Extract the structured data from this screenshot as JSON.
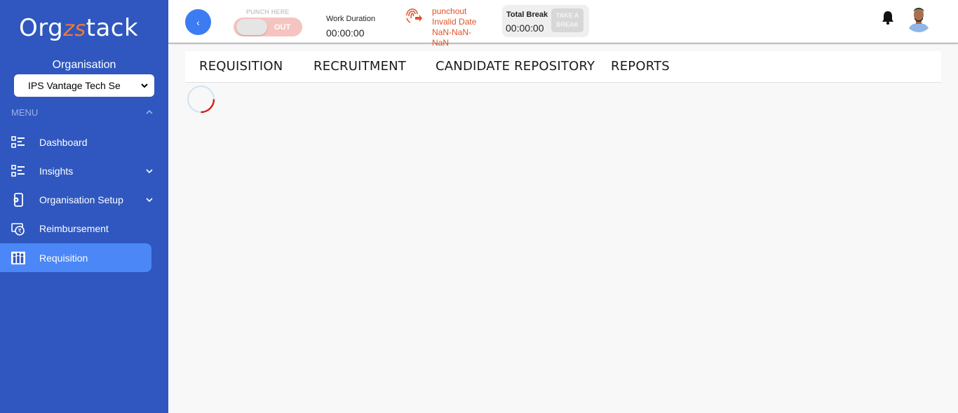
{
  "brand": {
    "logo_pre": "Org",
    "logo_mid": "zs",
    "logo_post": "tack"
  },
  "sidebar": {
    "org_label": "Organisation",
    "org_selected": "IPS Vantage Tech Se",
    "menu_label": "MENU",
    "items": [
      {
        "label": "Dashboard",
        "icon": "dashboard-icon",
        "has_chevron": false,
        "active": false
      },
      {
        "label": "Insights",
        "icon": "insights-icon",
        "has_chevron": true,
        "active": false
      },
      {
        "label": "Organisation Setup",
        "icon": "organisation-setup-icon",
        "has_chevron": true,
        "active": false
      },
      {
        "label": "Reimbursement",
        "icon": "reimbursement-icon",
        "has_chevron": false,
        "active": false
      },
      {
        "label": "Requisition",
        "icon": "requisition-icon",
        "has_chevron": false,
        "active": true
      }
    ]
  },
  "topbar": {
    "back_label": "‹",
    "punch_label": "PUNCH HERE",
    "punch_state": "OUT",
    "work_duration_label": "Work Duration",
    "work_duration_value": "00:00:00",
    "punch_status": "punchout",
    "punch_date_1": "Invalid Date",
    "punch_date_2": "NaN-NaN-",
    "punch_date_3": "NaN",
    "total_break_label": "Total Break",
    "total_break_value": "00:00:00",
    "take_break_line1": "TAKE A",
    "take_break_line2": "BREAK"
  },
  "tabs": [
    "REQUISITION",
    "RECRUITMENT",
    "CANDIDATE REPOSITORY",
    "REPORTS"
  ],
  "colors": {
    "sidebar": "#2f57bf",
    "active_item": "#4b87f7",
    "accent_orange": "#e0522a",
    "back_button": "#3b7cf2"
  }
}
